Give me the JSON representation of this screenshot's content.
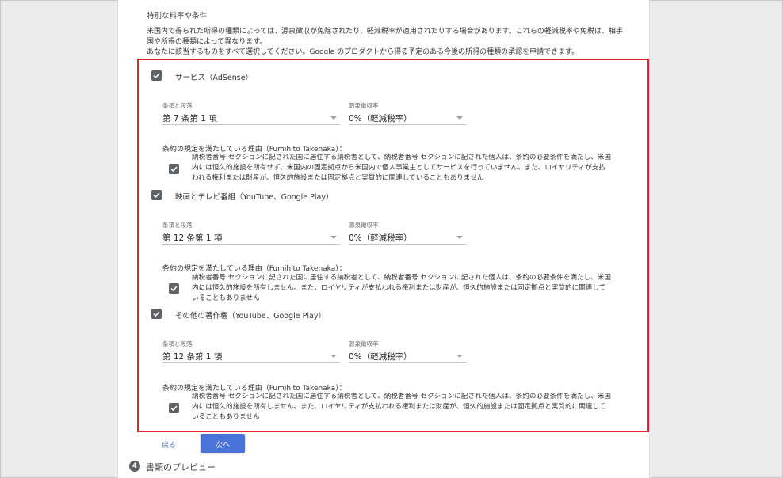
{
  "section": {
    "title": "特別な料率や条件",
    "description": [
      "米国内で得られた所得の種類によっては、源泉徴収が免除されたり、軽減税率が適用されたりする場合があります。これらの軽減税率や免税は、相手",
      "国や所得の種類によって異なります。",
      "あなたに該当するものをすべて選択してください。Google のプロダクトから得る予定のある今後の所得の種類の承認を申請できます。"
    ]
  },
  "items": [
    {
      "category": "サービス（AdSense）",
      "article_label": "条項と段落",
      "article_value": "第 7 条第 1 項",
      "rate_label": "源泉徴収率",
      "rate_value": "0%（軽減税率）",
      "reason_title": "条約の規定を満たしている理由（Fumihito Takenaka）：",
      "reason_lines": [
        "納税者番号 セクションに記された国に居住する納税者として、納税者番号 セクションに記された個人は、条約の必要条件を満たし、米国",
        "内には恒久的施設を所有せず、米国内の固定拠点から米国内で個人事業主としてサービスを行っていません。また、ロイヤリティが支払",
        "われる権利または財産が、恒久的施設または固定拠点と実質的に関連していることもありません"
      ]
    },
    {
      "category": "映画とテレビ番組（YouTube、Google Play）",
      "article_label": "条項と段落",
      "article_value": "第 12 条第 1 項",
      "rate_label": "源泉徴収率",
      "rate_value": "0%（軽減税率）",
      "reason_title": "条約の規定を満たしている理由（Fumihito Takenaka）：",
      "reason_lines": [
        "納税者番号 セクションに記された国に居住する納税者として、納税者番号 セクションに記された個人は、条約の必要条件を満たし、米国",
        "内には恒久的施設を所有しません。また、ロイヤリティが支払われる権利または財産が、恒久的施設または固定拠点と実質的に関連して",
        "いることもありません"
      ]
    },
    {
      "category": "その他の著作権（YouTube、Google Play）",
      "article_label": "条項と段落",
      "article_value": "第 12 条第 1 項",
      "rate_label": "源泉徴収率",
      "rate_value": "0%（軽減税率）",
      "reason_title": "条約の規定を満たしている理由（Fumihito Takenaka）：",
      "reason_lines": [
        "納税者番号 セクションに記された国に居住する納税者として、納税者番号 セクションに記された個人は、条約の必要条件を満たし、米国",
        "内には恒久的施設を所有しません。また、ロイヤリティが支払われる権利または財産が、恒久的施設または固定拠点と実質的に関連して",
        "いることもありません"
      ]
    }
  ],
  "actions": {
    "back_label": "戻る",
    "next_label": "次へ"
  },
  "next_step": {
    "number": "4",
    "title": "書類のプレビュー"
  },
  "colors": {
    "highlight": "#e0242c",
    "primary_button": "#4a73d9",
    "checkbox": "#5f6368",
    "link": "#4b79c8"
  },
  "icons": {
    "checkbox": "checkmark-icon",
    "dropdown": "triangle-down-icon"
  }
}
